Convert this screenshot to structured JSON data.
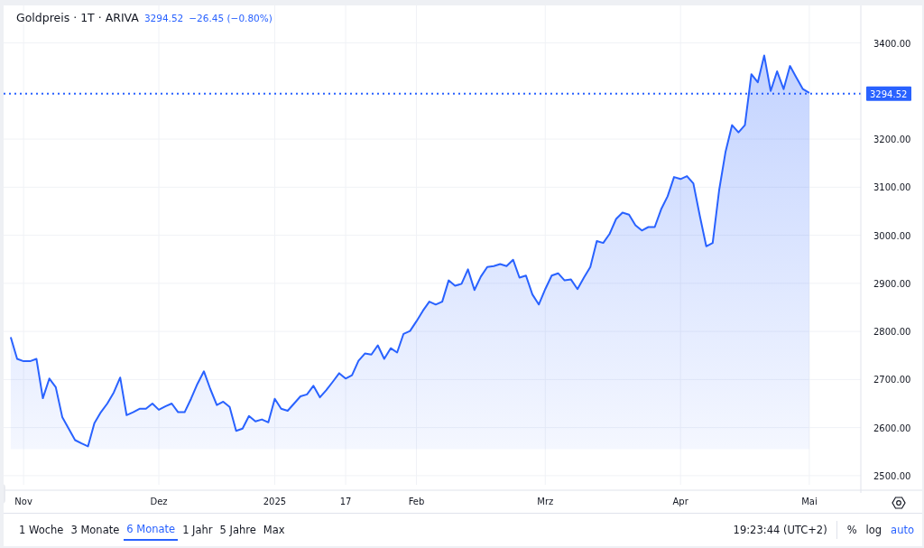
{
  "header": {
    "title": "Goldpreis · 1T · ARIVA",
    "price": "3294.52",
    "change": "−26.45 (−0.80%)"
  },
  "chart": {
    "chart_data": {
      "type": "area",
      "grid": true,
      "ref_lines": [
        {
          "axis": "y",
          "value": 3294.52,
          "label": "3294.52",
          "color": "#2962ff"
        }
      ],
      "categories": [
        null,
        null,
        "Nov",
        null,
        null,
        null,
        null,
        null,
        null,
        null,
        null,
        null,
        null,
        null,
        null,
        null,
        null,
        null,
        null,
        null,
        null,
        null,
        null,
        "Dez",
        null,
        null,
        null,
        null,
        null,
        null,
        null,
        null,
        null,
        null,
        null,
        null,
        null,
        null,
        null,
        null,
        null,
        "2025",
        null,
        null,
        null,
        null,
        null,
        null,
        null,
        null,
        null,
        null,
        "17",
        null,
        null,
        null,
        null,
        null,
        null,
        null,
        null,
        null,
        null,
        "Feb",
        null,
        null,
        null,
        null,
        null,
        null,
        null,
        null,
        null,
        null,
        null,
        null,
        null,
        null,
        null,
        null,
        null,
        null,
        null,
        "Mrz",
        null,
        null,
        null,
        null,
        null,
        null,
        null,
        null,
        null,
        null,
        null,
        null,
        null,
        null,
        null,
        null,
        null,
        null,
        null,
        null,
        "Apr",
        null,
        null,
        null,
        null,
        null,
        null,
        null,
        null,
        null,
        null,
        null,
        null,
        null,
        null,
        null,
        null,
        null,
        null,
        null,
        "Mai"
      ],
      "series": [
        {
          "color": "#2962ff",
          "values": [
            2788,
            2743,
            2738,
            2738,
            2743,
            2661,
            2702,
            2684,
            2622,
            2598,
            2574,
            2567,
            2561,
            2609,
            2632,
            2650,
            2673,
            2704,
            2626,
            2632,
            2639,
            2639,
            2650,
            2637,
            2644,
            2650,
            2632,
            2632,
            2660,
            2691,
            2717,
            2680,
            2647,
            2654,
            2643,
            2593,
            2598,
            2624,
            2613,
            2617,
            2611,
            2660,
            2639,
            2635,
            2650,
            2665,
            2669,
            2687,
            2663,
            2678,
            2695,
            2713,
            2702,
            2709,
            2739,
            2754,
            2752,
            2771,
            2743,
            2765,
            2756,
            2795,
            2801,
            2821,
            2843,
            2862,
            2856,
            2862,
            2906,
            2895,
            2899,
            2929,
            2886,
            2914,
            2934,
            2936,
            2940,
            2936,
            2949,
            2912,
            2916,
            2877,
            2856,
            2888,
            2916,
            2921,
            2906,
            2908,
            2888,
            2912,
            2934,
            2988,
            2984,
            3003,
            3034,
            3047,
            3043,
            3021,
            3010,
            3017,
            3017,
            3054,
            3081,
            3121,
            3117,
            3123,
            3108,
            3040,
            2977,
            2984,
            3094,
            3174,
            3229,
            3214,
            3229,
            3335,
            3318,
            3374,
            3300,
            3341,
            3304,
            3352,
            3328,
            3304,
            3296
          ]
        }
      ],
      "ylim": [
        2481,
        3478
      ],
      "yticks": [
        {
          "value": 2500,
          "label": "2500.00"
        },
        {
          "value": 2600,
          "label": "2600.00"
        },
        {
          "value": 2700,
          "label": "2700.00"
        },
        {
          "value": 2800,
          "label": "2800.00"
        },
        {
          "value": 2900,
          "label": "2900.00"
        },
        {
          "value": 3000,
          "label": "3000.00"
        },
        {
          "value": 3100,
          "label": "3100.00"
        },
        {
          "value": 3200,
          "label": "3200.00"
        },
        {
          "value": 3400,
          "label": "3400.00"
        }
      ]
    }
  },
  "range_buttons": [
    {
      "label": "1 Woche",
      "selected": false
    },
    {
      "label": "3 Monate",
      "selected": false
    },
    {
      "label": "6 Monate",
      "selected": true
    },
    {
      "label": "1 Jahr",
      "selected": false
    },
    {
      "label": "5 Jahre",
      "selected": false
    },
    {
      "label": "Max",
      "selected": false
    }
  ],
  "clock": "19:23:44 (UTC+2)",
  "scale_options": [
    {
      "label": "%",
      "selected": false
    },
    {
      "label": "log",
      "selected": false
    },
    {
      "label": "auto",
      "selected": true
    }
  ]
}
